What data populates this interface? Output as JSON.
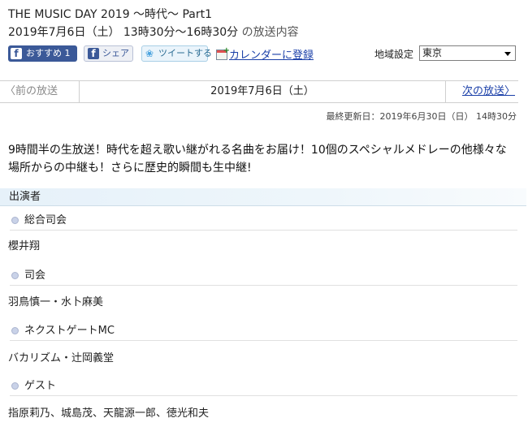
{
  "program": {
    "title": "THE MUSIC DAY 2019 〜時代〜 Part1",
    "air_time": "2019年7月6日（土） 13時30分〜16時30分",
    "air_time_suffix": "の放送内容"
  },
  "share": {
    "fb_label": "おすすめ 1",
    "fb_icon_char": "f",
    "share_label": "シェア",
    "share_icon_char": "f",
    "tweet_label": "ツイートする",
    "calendar_label": "カレンダーに登録"
  },
  "region": {
    "label": "地域設定",
    "selected": "東京"
  },
  "nav": {
    "prev_label": "〈前の放送",
    "current_date": "2019年7月6日（土）",
    "next_label": "次の放送〉"
  },
  "updated": "最終更新日：2019年6月30日（日） 14時30分",
  "description": "9時間半の生放送！時代を超え歌い継がれる名曲をお届け！10個のスペシャルメドレーの他様々な場所からの中継も！さらに歴史的瞬間も生中継!",
  "cast": {
    "header": "出演者",
    "roles": [
      {
        "role": "総合司会",
        "names": "櫻井翔"
      },
      {
        "role": "司会",
        "names": "羽鳥慎一・水卜麻美"
      },
      {
        "role": "ネクストゲートMC",
        "names": "バカリズム・辻岡義堂"
      },
      {
        "role": "ゲスト",
        "names": "指原莉乃、城島茂、天龍源一郎、徳光和夫"
      }
    ]
  },
  "icons": {
    "facebook": "facebook-icon",
    "twitter": "twitter-bird-icon",
    "calendar": "calendar-add-icon",
    "dropdown": "chevron-down-icon",
    "bullet": "bullet-dot-icon"
  },
  "colors": {
    "facebook_blue": "#3b5998",
    "link_blue": "#1a3fa8",
    "section_bg": "#e6f1f9"
  }
}
